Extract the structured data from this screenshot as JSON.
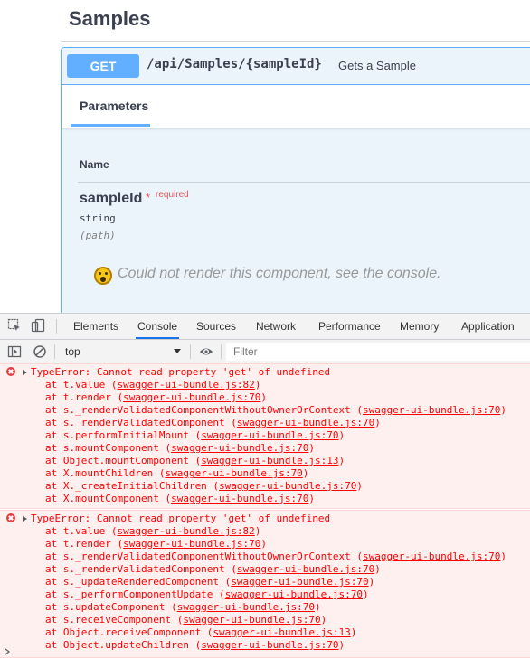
{
  "swagger": {
    "section_title": "Samples",
    "operation": {
      "method": "GET",
      "path": "/api/Samples/{sampleId}",
      "summary": "Gets a Sample"
    },
    "tab_label": "Parameters",
    "table_header_name": "Name",
    "parameter": {
      "name": "sampleId",
      "required_star": "*",
      "required_label": "required",
      "type": "string",
      "in": "(path)"
    },
    "error_message": "Could not render this component, see the console."
  },
  "devtools": {
    "tabs": [
      "Elements",
      "Console",
      "Sources",
      "Network",
      "Performance",
      "Memory",
      "Application"
    ],
    "active_tab": "Console",
    "context": "top",
    "filter_placeholder": "Filter",
    "errors": [
      {
        "message": "TypeError: Cannot read property 'get' of undefined",
        "frames": [
          {
            "at": "at t.value (",
            "loc": "swagger-ui-bundle.js:82",
            "end": ")"
          },
          {
            "at": "at t.render (",
            "loc": "swagger-ui-bundle.js:70",
            "end": ")"
          },
          {
            "at": "at s._renderValidatedComponentWithoutOwnerOrContext (",
            "loc": "swagger-ui-bundle.js:70",
            "end": ")"
          },
          {
            "at": "at s._renderValidatedComponent (",
            "loc": "swagger-ui-bundle.js:70",
            "end": ")"
          },
          {
            "at": "at s.performInitialMount (",
            "loc": "swagger-ui-bundle.js:70",
            "end": ")"
          },
          {
            "at": "at s.mountComponent (",
            "loc": "swagger-ui-bundle.js:70",
            "end": ")"
          },
          {
            "at": "at Object.mountComponent (",
            "loc": "swagger-ui-bundle.js:13",
            "end": ")"
          },
          {
            "at": "at X.mountChildren (",
            "loc": "swagger-ui-bundle.js:70",
            "end": ")"
          },
          {
            "at": "at X._createInitialChildren (",
            "loc": "swagger-ui-bundle.js:70",
            "end": ")"
          },
          {
            "at": "at X.mountComponent (",
            "loc": "swagger-ui-bundle.js:70",
            "end": ")"
          }
        ]
      },
      {
        "message": "TypeError: Cannot read property 'get' of undefined",
        "frames": [
          {
            "at": "at t.value (",
            "loc": "swagger-ui-bundle.js:82",
            "end": ")"
          },
          {
            "at": "at t.render (",
            "loc": "swagger-ui-bundle.js:70",
            "end": ")"
          },
          {
            "at": "at s._renderValidatedComponentWithoutOwnerOrContext (",
            "loc": "swagger-ui-bundle.js:70",
            "end": ")"
          },
          {
            "at": "at s._renderValidatedComponent (",
            "loc": "swagger-ui-bundle.js:70",
            "end": ")"
          },
          {
            "at": "at s._updateRenderedComponent (",
            "loc": "swagger-ui-bundle.js:70",
            "end": ")"
          },
          {
            "at": "at s._performComponentUpdate (",
            "loc": "swagger-ui-bundle.js:70",
            "end": ")"
          },
          {
            "at": "at s.updateComponent (",
            "loc": "swagger-ui-bundle.js:70",
            "end": ")"
          },
          {
            "at": "at s.receiveComponent (",
            "loc": "swagger-ui-bundle.js:70",
            "end": ")"
          },
          {
            "at": "at Object.receiveComponent (",
            "loc": "swagger-ui-bundle.js:13",
            "end": ")"
          },
          {
            "at": "at Object.updateChildren (",
            "loc": "swagger-ui-bundle.js:70",
            "end": ")"
          }
        ]
      }
    ]
  }
}
